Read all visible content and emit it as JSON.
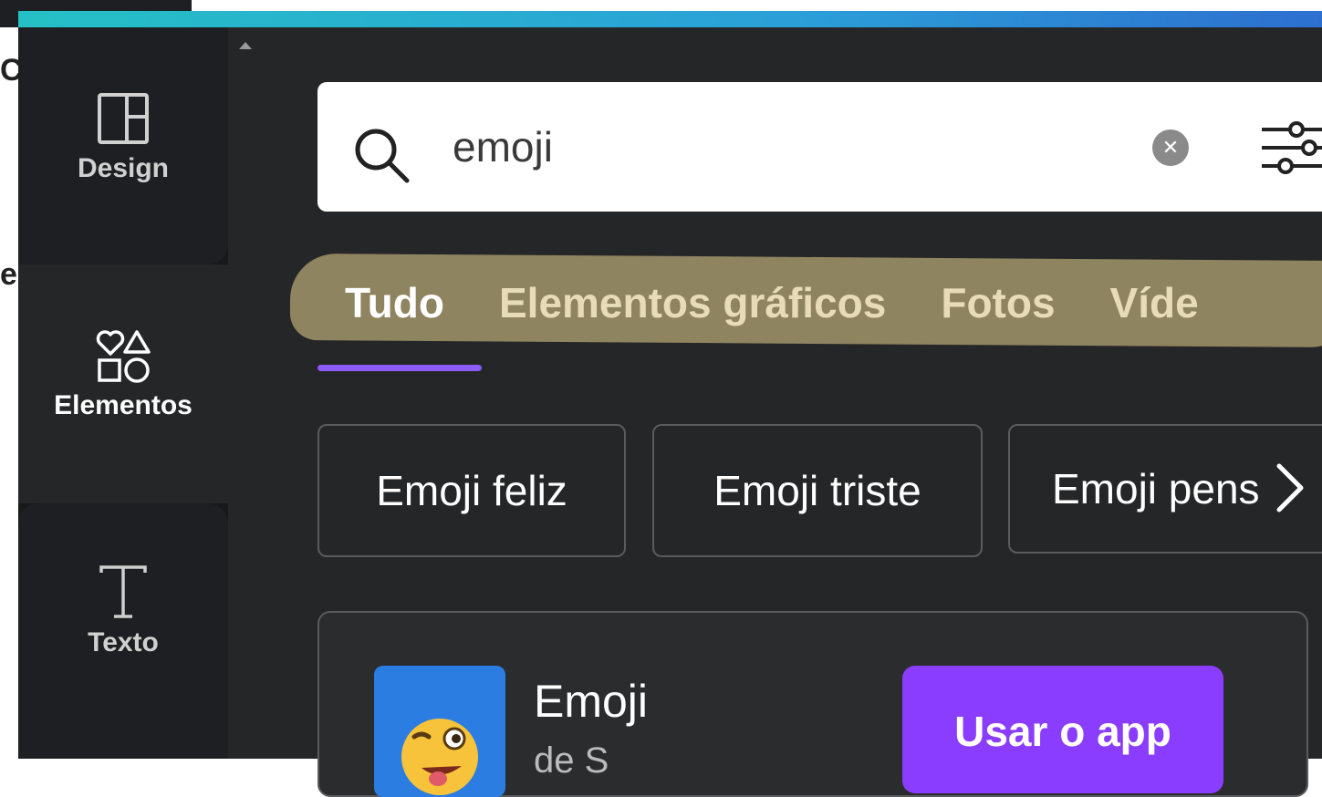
{
  "sidebar": {
    "items": [
      {
        "label": "Design",
        "icon": "layout-icon"
      },
      {
        "label": "Elementos",
        "icon": "shapes-icon"
      },
      {
        "label": "Texto",
        "icon": "text-icon"
      }
    ]
  },
  "left_fragments": [
    "C",
    "e"
  ],
  "search": {
    "value": "emoji",
    "clear_icon": "close-icon",
    "filter_icon": "filter-sliders-icon"
  },
  "tabs": [
    {
      "label": "Tudo",
      "active": true
    },
    {
      "label": "Elementos gráficos",
      "active": false
    },
    {
      "label": "Fotos",
      "active": false
    },
    {
      "label": "Víde",
      "active": false
    }
  ],
  "suggestions": [
    {
      "label": "Emoji feliz"
    },
    {
      "label": "Emoji triste"
    },
    {
      "label": "Emoji pens"
    }
  ],
  "app_card": {
    "name": "Emoji",
    "subtitle": "de S",
    "button_label": "Usar o app"
  },
  "colors": {
    "accent": "#8b3dff",
    "tab_underline": "#8b5cf6",
    "highlight": "#8f8460",
    "gradient_start": "#25c0c6",
    "gradient_end": "#2d6fcf"
  }
}
